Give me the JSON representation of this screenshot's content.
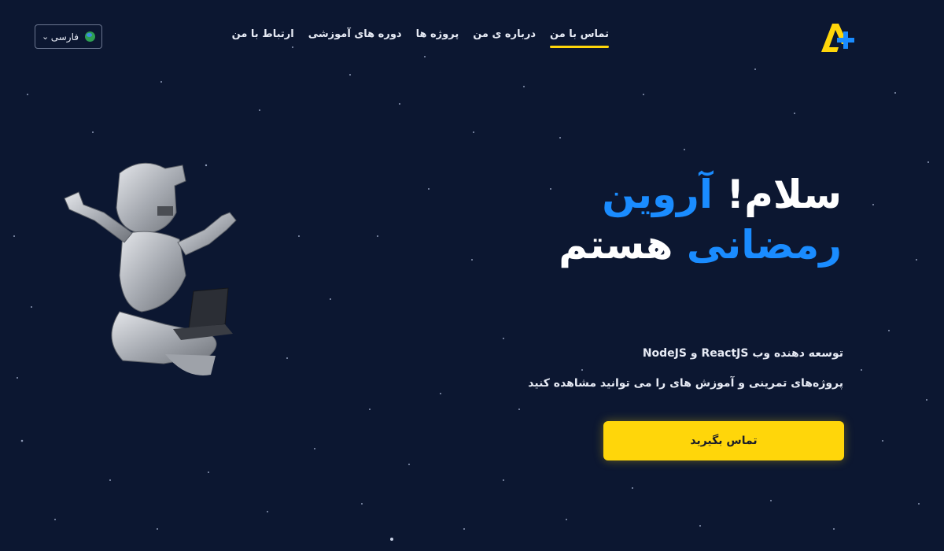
{
  "colors": {
    "background": "#0c1731",
    "accent_blue": "#1a8cff",
    "accent_yellow": "#ffd60a",
    "text": "#e7ebf5"
  },
  "header": {
    "logo_icon": "a-plus-logo-icon",
    "nav": [
      {
        "label": "تماس با من",
        "active": true
      },
      {
        "label": "درباره ی من",
        "active": false
      },
      {
        "label": "پروژه ها",
        "active": false
      },
      {
        "label": "دوره های آموزشی",
        "active": false
      },
      {
        "label": "ارتباط با من",
        "active": false
      }
    ],
    "language": {
      "label": "فارسی",
      "icon": "globe-icon",
      "chevron": "chevron-down-icon"
    }
  },
  "hero": {
    "greeting_white": "سلام!",
    "name_first": "آروین",
    "name_last": "رمضانی",
    "suffix_white": "هستم",
    "line1": "توسعه دهنده وب ReactJS و NodeJS",
    "line2": "پروژه‌های تمرینی و آموزش های را می توانید مشاهده کنید",
    "cta": "تماس بگیرید",
    "illustration_icon": "knight-with-laptop-icon"
  }
}
